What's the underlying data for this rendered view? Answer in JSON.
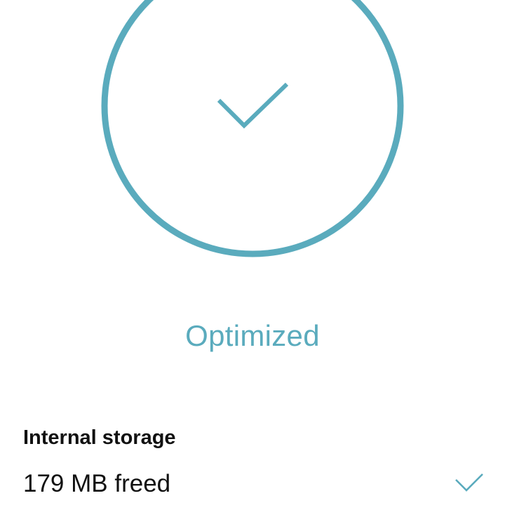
{
  "status": {
    "label": "Optimized",
    "icon": "checkmark-icon",
    "accent_color": "#5aabbd"
  },
  "storage": {
    "title": "Internal storage",
    "freed_text": "179 MB freed",
    "done_icon": "checkmark-icon"
  }
}
